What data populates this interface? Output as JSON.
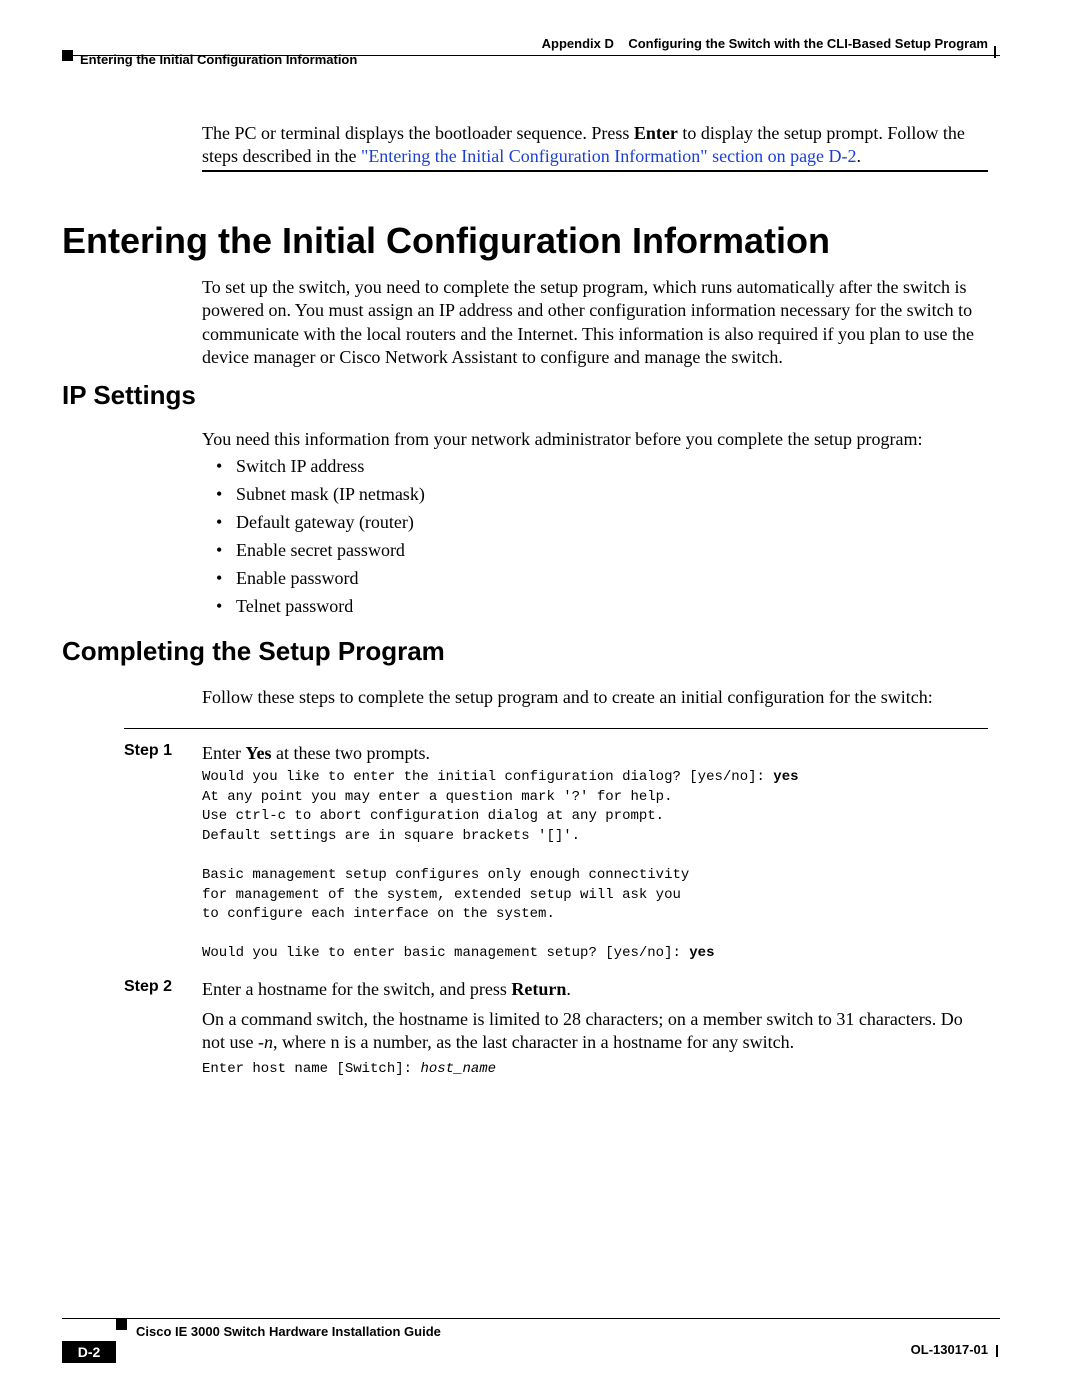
{
  "header": {
    "appendix_label": "Appendix D",
    "appendix_title": "Configuring the Switch with the CLI-Based Setup Program",
    "chapter_sub": "Entering the Initial Configuration Information"
  },
  "intro": {
    "text_prefix": "The PC or terminal displays the bootloader sequence. Press ",
    "text_bold1": "Enter",
    "text_mid": " to display the setup prompt. Follow the steps described in the ",
    "link_text": "\"Entering the Initial Configuration Information\" section on page D-2",
    "text_suffix": "."
  },
  "h1": "Entering the Initial Configuration Information",
  "setup_para": "To set up the switch, you need to complete the setup program, which runs automatically after the switch is powered on. You must assign an IP address and other configuration information necessary for the switch to communicate with the local routers and the Internet. This information is also required if you plan to use the device manager or Cisco Network Assistant to configure and manage the switch.",
  "h2_ip": "IP Settings",
  "ip_intro": "You need this information from your network administrator before you complete the setup program:",
  "ip_list": [
    "Switch IP address",
    "Subnet mask (IP netmask)",
    "Default gateway (router)",
    "Enable secret password",
    "Enable password",
    "Telnet password"
  ],
  "h2_complete": "Completing the Setup Program",
  "follow_para": "Follow these steps to complete the setup program and to create an initial configuration for the switch:",
  "step1": {
    "label": "Step 1",
    "text_prefix": "Enter ",
    "text_bold": "Yes",
    "text_suffix": " at these two prompts.",
    "code_line1": "Would you like to enter the initial configuration dialog? [yes/no]: ",
    "code_bold1": "yes",
    "code_block": "\nAt any point you may enter a question mark '?' for help.\nUse ctrl-c to abort configuration dialog at any prompt.\nDefault settings are in square brackets '[]'.\n\nBasic management setup configures only enough connectivity\nfor management of the system, extended setup will ask you\nto configure each interface on the system.\n\nWould you like to enter basic management setup? [yes/no]: ",
    "code_bold2": "yes"
  },
  "step2": {
    "label": "Step 2",
    "text_prefix": "Enter a hostname for the switch, and press ",
    "text_bold": "Return",
    "text_suffix": ".",
    "para_prefix": "On a command switch, the hostname is limited to 28 characters; on a member switch to 31 characters. Do not use ",
    "para_italic": "-n",
    "para_suffix": ", where n is a number, as the last character in a hostname for any switch.",
    "code_prefix": "Enter host name [Switch]: ",
    "code_italic": "host_name"
  },
  "footer": {
    "title": "Cisco IE 3000 Switch Hardware Installation Guide",
    "pagenum": "D-2",
    "docnum": "OL-13017-01"
  }
}
